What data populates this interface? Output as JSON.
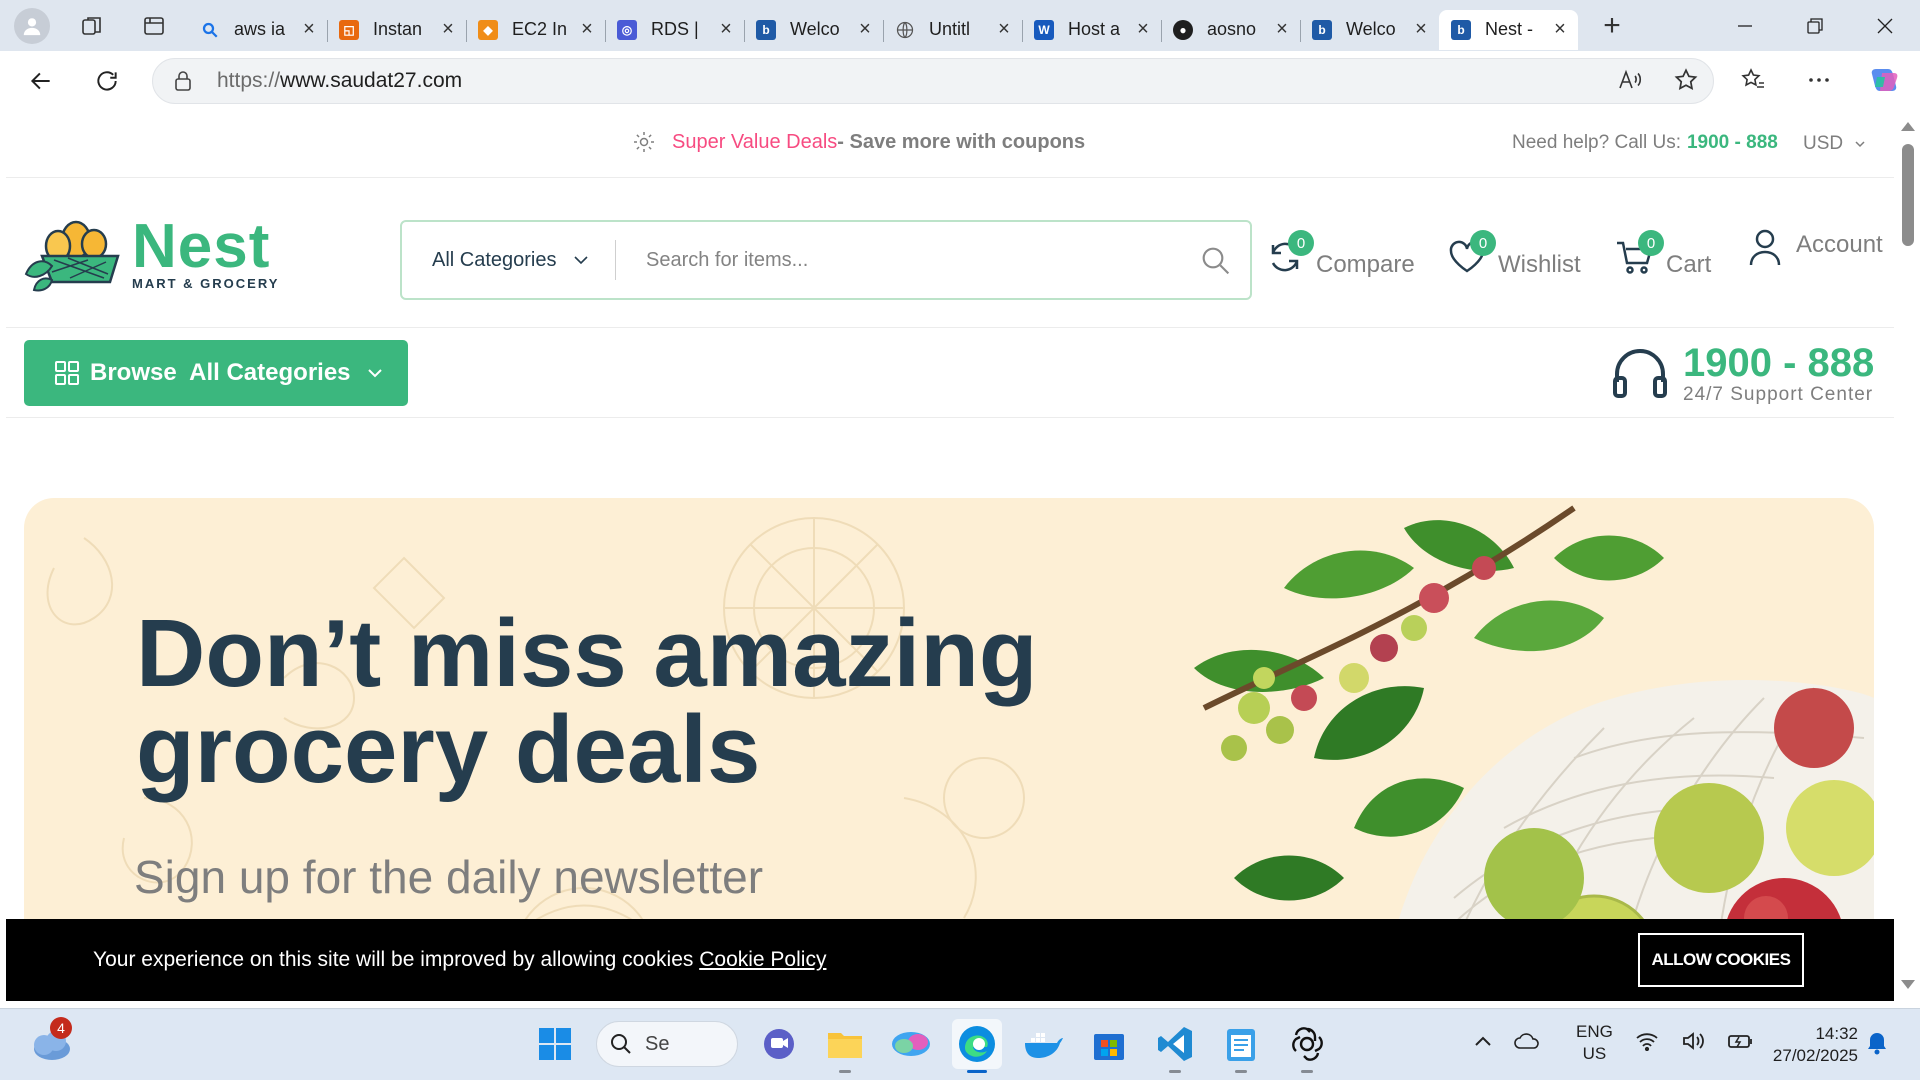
{
  "browser": {
    "tabs": [
      {
        "title": "aws ia",
        "favicon": "search-icon",
        "color": "#1a73e8"
      },
      {
        "title": "Instan",
        "favicon": "aws-instance-icon",
        "color": "#e8690f"
      },
      {
        "title": "EC2 In",
        "favicon": "aws-ec2-icon",
        "color": "#f08d18"
      },
      {
        "title": "RDS |",
        "favicon": "aws-rds-icon",
        "color": "#4a5bd6"
      },
      {
        "title": "Welco",
        "favicon": "b-icon",
        "color": "#1f5aa6"
      },
      {
        "title": "Untitl",
        "favicon": "globe-icon",
        "color": "#6b6b6b"
      },
      {
        "title": "Host a",
        "favicon": "word-icon",
        "color": "#185abd"
      },
      {
        "title": "aosno",
        "favicon": "github-icon",
        "color": "#1f1f1f"
      },
      {
        "title": "Welco",
        "favicon": "b-icon",
        "color": "#1f5aa6"
      },
      {
        "title": "Nest -",
        "favicon": "b-icon",
        "color": "#1f5aa6"
      }
    ],
    "url_protocol": "https://",
    "url_host": "www.saudat27.com"
  },
  "topbar": {
    "deals_highlight": "Super Value Deals",
    "deals_rest": " - Save more with coupons",
    "help_label": "Need help? Call Us:",
    "help_phone": "1900 - 888",
    "currency": "USD"
  },
  "header": {
    "logo_name": "Nest",
    "logo_sub": "MART & GROCERY",
    "category_select": "All Categories",
    "search_placeholder": "Search for items...",
    "compare_label": "Compare",
    "compare_count": "0",
    "wishlist_label": "Wishlist",
    "wishlist_count": "0",
    "cart_label": "Cart",
    "cart_count": "0",
    "account_label": "Account"
  },
  "nav": {
    "browse_label": "Browse  All Categories",
    "support_number": "1900 - 888",
    "support_sub": "24/7 Support Center"
  },
  "hero": {
    "title_line1": "Don’t miss amazing",
    "title_line2": "grocery deals",
    "subtitle": "Sign up for the daily newsletter"
  },
  "cookie": {
    "text": "Your experience on this site will be improved by allowing cookies ",
    "link": "Cookie Policy",
    "button": "ALLOW COOKIES"
  },
  "taskbar": {
    "weather_badge": "4",
    "search_text": "Se",
    "lang_line1": "ENG",
    "lang_line2": "US",
    "time": "14:32",
    "date": "27/02/2025"
  },
  "colors": {
    "brand_green": "#3bb77e",
    "deals_red": "#f74b81",
    "heading_dark": "#253d4e",
    "hero_bg": "#fdefd5"
  }
}
